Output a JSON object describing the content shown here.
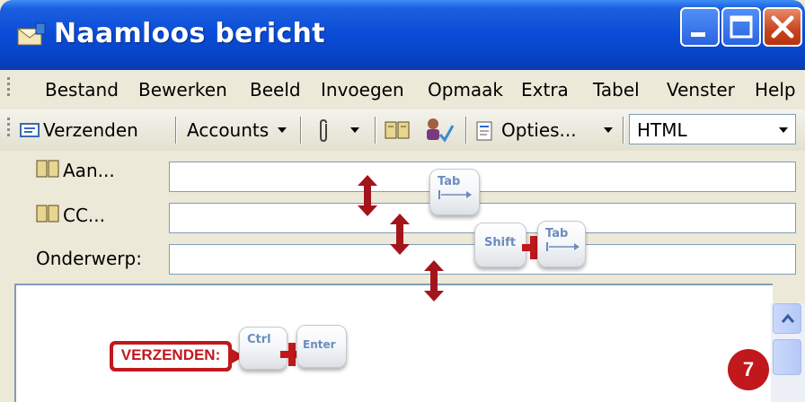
{
  "window": {
    "title": "Naamloos bericht"
  },
  "menu": [
    {
      "label": "Bestand"
    },
    {
      "label": "Bewerken"
    },
    {
      "label": "Beeld"
    },
    {
      "label": "Invoegen"
    },
    {
      "label": "Opmaak"
    },
    {
      "label": "Extra"
    },
    {
      "label": "Tabel"
    },
    {
      "label": "Venster"
    },
    {
      "label": "Help"
    }
  ],
  "toolbar": {
    "send_label": "Verzenden",
    "accounts_label": "Accounts",
    "options_label": "Opties...",
    "format_value": "HTML"
  },
  "fields": {
    "to_label": "Aan...",
    "cc_label": "CC...",
    "subject_label": "Onderwerp:",
    "to_value": "",
    "cc_value": "",
    "subject_value": ""
  },
  "annotations": {
    "key_tab": "Tab",
    "key_shift": "Shift",
    "key_tab2": "Tab",
    "send_tag": "VERZENDEN:",
    "key_ctrl": "Ctrl",
    "key_enter": "Enter",
    "step_number": "7"
  },
  "colors": {
    "titlebar": "#0a4bd6",
    "accent_red": "#c0181d",
    "close_button": "#c8431d"
  },
  "icons": [
    "window-app-icon",
    "minimize-icon",
    "maximize-icon",
    "close-icon",
    "send-icon",
    "dropdown-arrow-icon",
    "paperclip-icon",
    "address-book-icon",
    "check-names-icon",
    "options-icon",
    "scroll-up-icon"
  ]
}
